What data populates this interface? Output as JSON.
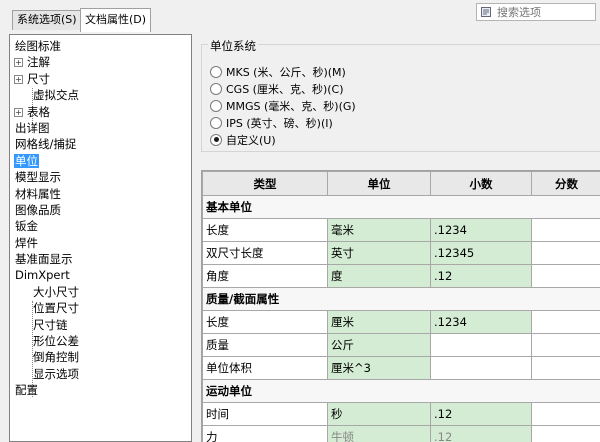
{
  "tabs": [
    {
      "label": "系统选项(S)",
      "active": false
    },
    {
      "label": "文档属性(D)",
      "active": true
    }
  ],
  "search": {
    "placeholder": "搜索选项"
  },
  "tree": {
    "items": [
      {
        "label": "绘图标准",
        "expander": ""
      },
      {
        "label": "注解",
        "expander": "+"
      },
      {
        "label": "尺寸",
        "expander": "+"
      },
      {
        "label": "虚拟交点",
        "expander": ""
      },
      {
        "label": "表格",
        "expander": "+"
      },
      {
        "label": "出详图",
        "expander": ""
      },
      {
        "label": "网格线/捕捉",
        "expander": ""
      },
      {
        "label": "单位",
        "expander": "",
        "selected": true
      },
      {
        "label": "模型显示",
        "expander": ""
      },
      {
        "label": "材料属性",
        "expander": ""
      },
      {
        "label": "图像品质",
        "expander": ""
      },
      {
        "label": "钣金",
        "expander": ""
      },
      {
        "label": "焊件",
        "expander": ""
      },
      {
        "label": "基准面显示",
        "expander": ""
      },
      {
        "label": "DimXpert",
        "expander": ""
      },
      {
        "label": "大小尺寸",
        "expander": ""
      },
      {
        "label": "位置尺寸",
        "expander": ""
      },
      {
        "label": "尺寸链",
        "expander": ""
      },
      {
        "label": "形位公差",
        "expander": ""
      },
      {
        "label": "倒角控制",
        "expander": ""
      },
      {
        "label": "显示选项",
        "expander": ""
      },
      {
        "label": "配置",
        "expander": ""
      }
    ]
  },
  "unit_system": {
    "legend": "单位系统",
    "options": [
      {
        "label": "MKS (米、公斤、秒)(M)",
        "checked": false
      },
      {
        "label": "CGS (厘米、克、秒)(C)",
        "checked": false
      },
      {
        "label": "MMGS (毫米、克、秒)(G)",
        "checked": false
      },
      {
        "label": "IPS (英寸、磅、秒)(I)",
        "checked": false
      },
      {
        "label": "自定义(U)",
        "checked": true
      }
    ]
  },
  "grid": {
    "headers": [
      "类型",
      "单位",
      "小数",
      "分数"
    ],
    "rows": [
      {
        "section": "基本单位"
      },
      {
        "cells": [
          "长度",
          "毫米",
          ".1234",
          ""
        ]
      },
      {
        "cells": [
          "双尺寸长度",
          "英寸",
          ".12345",
          ""
        ]
      },
      {
        "cells": [
          "角度",
          "度",
          ".12",
          ""
        ]
      },
      {
        "section": "质量/截面属性"
      },
      {
        "cells": [
          "长度",
          "厘米",
          ".1234",
          ""
        ]
      },
      {
        "cells": [
          "质量",
          "公斤",
          "",
          ""
        ]
      },
      {
        "cells": [
          "单位体积",
          "厘米^3",
          "",
          ""
        ]
      },
      {
        "section": "运动单位"
      },
      {
        "cells": [
          "时间",
          "秒",
          ".12",
          ""
        ]
      },
      {
        "cells": [
          "力",
          "牛顿",
          ".12",
          ""
        ]
      }
    ]
  }
}
